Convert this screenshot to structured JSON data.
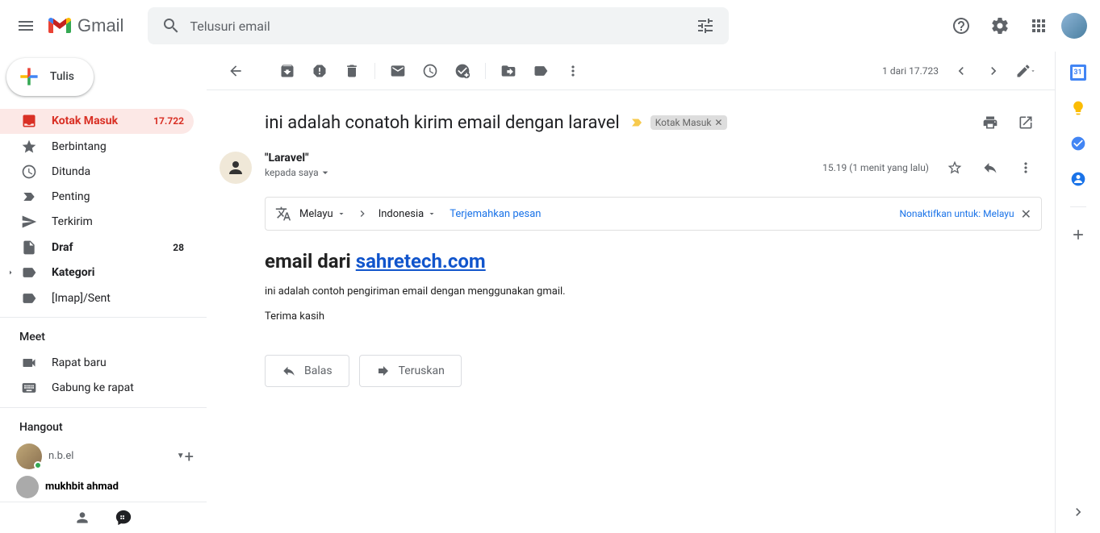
{
  "header": {
    "product": "Gmail",
    "search_placeholder": "Telusuri email"
  },
  "compose_label": "Tulis",
  "nav": {
    "inbox": {
      "label": "Kotak Masuk",
      "count": "17.722"
    },
    "starred": {
      "label": "Berbintang"
    },
    "snoozed": {
      "label": "Ditunda"
    },
    "important": {
      "label": "Penting"
    },
    "sent": {
      "label": "Terkirim"
    },
    "drafts": {
      "label": "Draf",
      "count": "28"
    },
    "categories": {
      "label": "Kategori"
    },
    "imap_sent": {
      "label": "[Imap]/Sent"
    }
  },
  "meet": {
    "section": "Meet",
    "new": "Rapat baru",
    "join": "Gabung ke rapat"
  },
  "hangouts": {
    "section": "Hangout",
    "me": "n.b.el",
    "contact1": "mukhbit ahmad"
  },
  "toolbar": {
    "pager": "1 dari 17.723"
  },
  "email": {
    "subject": "ini adalah conatoh kirim email dengan laravel",
    "label_chip": "Kotak Masuk",
    "sender_name": "\"Laravel\"",
    "sender_to_prefix": "kepada saya",
    "time": "15.19 (1 menit yang lalu)",
    "translate": {
      "from": "Melayu",
      "to": "Indonesia",
      "action": "Terjemahkan pesan",
      "disable": "Nonaktifkan untuk: Melayu"
    },
    "body": {
      "heading_prefix": "email dari ",
      "heading_link": "sahretech.com",
      "p1": "ini adalah contoh pengiriman email dengan menggunakan gmail.",
      "p2": "Terima kasih"
    },
    "actions": {
      "reply": "Balas",
      "forward": "Teruskan"
    }
  }
}
